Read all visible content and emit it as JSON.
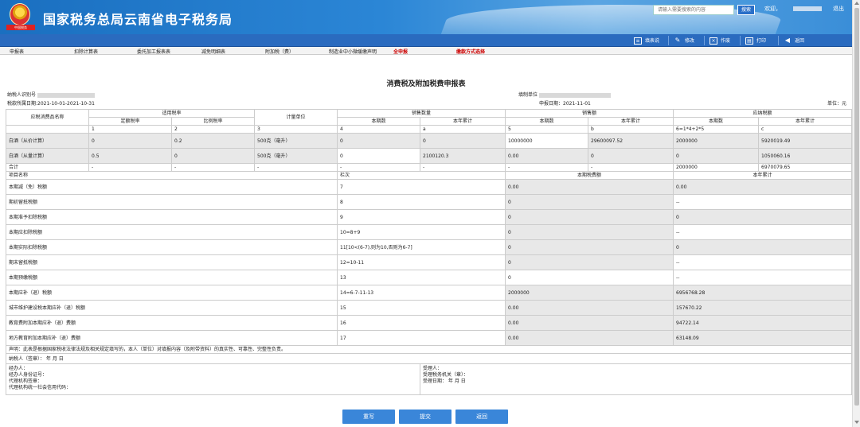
{
  "header": {
    "seal_text": "中国税务",
    "title": "国家税务总局云南省电子税务局",
    "search_placeholder": "请输入需要搜索的内容",
    "search_button": "搜索",
    "welcome": "欢迎，",
    "logout": "退出"
  },
  "toolbar": {
    "items": [
      {
        "label": "填表说",
        "icon": "form-icon"
      },
      {
        "label": "修改",
        "icon": "edit-pencil-icon"
      },
      {
        "label": "作废",
        "icon": "void-document-icon"
      },
      {
        "label": "打印",
        "icon": "printer-icon"
      },
      {
        "label": "返回",
        "icon": "back-arrow-icon"
      }
    ]
  },
  "nav": {
    "items": [
      "申报表",
      "扣除计算表",
      "委托加工报表表",
      "减免明细表",
      "附加税（费）",
      "制造业中小微缓缴声明",
      "全申报",
      "缴款方式选择"
    ]
  },
  "form": {
    "title": "消费税及附加税费申报表",
    "taxpayer_id_label": "纳税人识别号",
    "period": "税款所属日期:2021-10-01-2021-10-31",
    "filler_label": "填制单位",
    "report_date": "申报日期：2021-11-01",
    "unit": "单位：元"
  },
  "table": {
    "h_item": "应税消费品名称",
    "h_rate": "适用税率",
    "h_rate_fixed": "定额税率",
    "h_rate_prop": "比例税率",
    "h_unit": "计量单位",
    "h_qty": "销售数量",
    "h_amt": "销售额",
    "h_tax": "应纳税额",
    "h_current": "本期数",
    "h_ytd": "本年累计",
    "idx": [
      "1",
      "2",
      "3",
      "4",
      "a",
      "5",
      "b",
      "6=1*4+2*5",
      "c"
    ],
    "rows": [
      {
        "name": "白酒（从价计算）",
        "c1": "0",
        "c2": "0.2",
        "c3": "500克（毫升）",
        "c4": "0",
        "c5": "0",
        "c6": "10000000",
        "c7": "29600097.52",
        "c8": "2000000",
        "c9": "5920019.49"
      },
      {
        "name": "白酒（从量计算）",
        "c1": "0.5",
        "c2": "0",
        "c3": "500克（毫升）",
        "c4": "0",
        "c5": "2100120.3",
        "c6": "0.00",
        "c7": "0",
        "c8": "0",
        "c9": "1050060.16"
      }
    ],
    "total": {
      "name": "合计",
      "c1": "-",
      "c2": "-",
      "c3": "-",
      "c4": "-",
      "c5": "-",
      "c6": "-",
      "c7": "-",
      "c8": "2000000",
      "c9": "6970079.65"
    },
    "h2_name": "项目名称",
    "h2_seq": "栏次",
    "h2_current": "本期税费额",
    "h2_ytd": "本年累计",
    "items": [
      {
        "name": "本期减（免）税额",
        "seq": "7",
        "cur": "0.00",
        "ytd": "0.00"
      },
      {
        "name": "期初留抵税额",
        "seq": "8",
        "cur": "0",
        "ytd": "--"
      },
      {
        "name": "本期准予扣除税额",
        "seq": "9",
        "cur": "0",
        "ytd": "0"
      },
      {
        "name": "本期应扣除税额",
        "seq": "10=8+9",
        "cur": "0",
        "ytd": "--"
      },
      {
        "name": "本期实际扣除税额",
        "seq": "11[10<(6-7),则为10,否则为6-7]",
        "cur": "0",
        "ytd": "0"
      },
      {
        "name": "期末留抵税额",
        "seq": "12=10-11",
        "cur": "0",
        "ytd": "--"
      },
      {
        "name": "本期预缴税额",
        "seq": "13",
        "cur": "0",
        "ytd": "--"
      },
      {
        "name": "本期应补（退）税额",
        "seq": "14=6-7-11-13",
        "cur": "2000000",
        "ytd": "6956768.28"
      },
      {
        "name": "城市维护建设税本期应补（退）税额",
        "seq": "15",
        "cur": "0.00",
        "ytd": "157670.22"
      },
      {
        "name": "教育费附加本期应补（退）费额",
        "seq": "16",
        "cur": "0.00",
        "ytd": "94722.14"
      },
      {
        "name": "地方教育附加本期应补（退）费额",
        "seq": "17",
        "cur": "0.00",
        "ytd": "63148.09"
      }
    ],
    "declaration": "声明：此表是根据国家税收法律法规及相关规定填写的，本人（单位）对填报内容（及附带资料）的真实性、可靠性、完整性负责。",
    "sign_line": "纳税人（签章）：          年     月     日",
    "left_block": [
      "经办人：",
      "经办人身份证号：",
      "代理机构签章：",
      "代理机构统一社会信用代码："
    ],
    "right_block": [
      "受理人：",
      "受理税务机关（章）：",
      "受理日期：      年     月     日"
    ]
  },
  "actions": {
    "reset": "重写",
    "submit": "提交",
    "back": "返回"
  },
  "colors": {
    "header_blue": "#2b86d6",
    "toolbar_blue": "#2a6bbf",
    "button_blue": "#3a86d9",
    "cell_gray": "#e8e8e8",
    "nav_red": "#cc0000"
  }
}
